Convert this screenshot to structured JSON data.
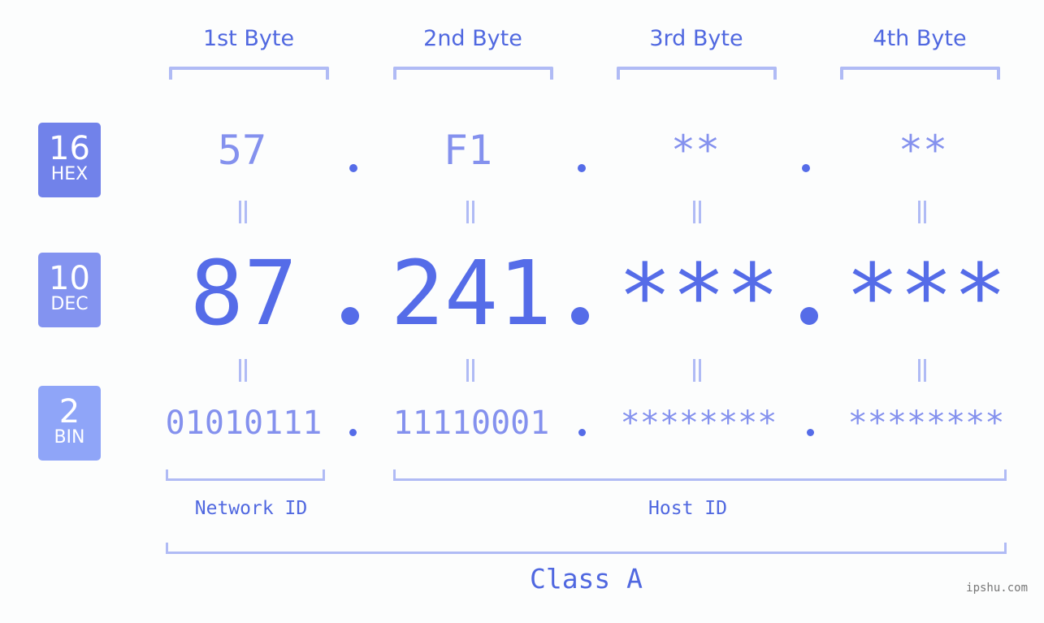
{
  "byte_headers": [
    "1st Byte",
    "2nd Byte",
    "3rd Byte",
    "4th Byte"
  ],
  "badges": {
    "hex": {
      "number": "16",
      "label": "HEX",
      "color": "#7182ea"
    },
    "dec": {
      "number": "10",
      "label": "DEC",
      "color": "#8393f0"
    },
    "bin": {
      "number": "2",
      "label": "BIN",
      "color": "#8fa5f8"
    }
  },
  "hex_values": [
    "57",
    "F1",
    "**",
    "**"
  ],
  "dec_values": [
    "87",
    "241",
    "***",
    "***"
  ],
  "bin_values": [
    "01010111",
    "11110001",
    "********",
    "********"
  ],
  "separator": ".",
  "network_label": "Network ID",
  "host_label": "Host ID",
  "class_label": "Class A",
  "watermark": "ipshu.com",
  "colors": {
    "accent": "#556ce8",
    "bracket": "#b0bbf5",
    "light_text": "#8491ee"
  }
}
